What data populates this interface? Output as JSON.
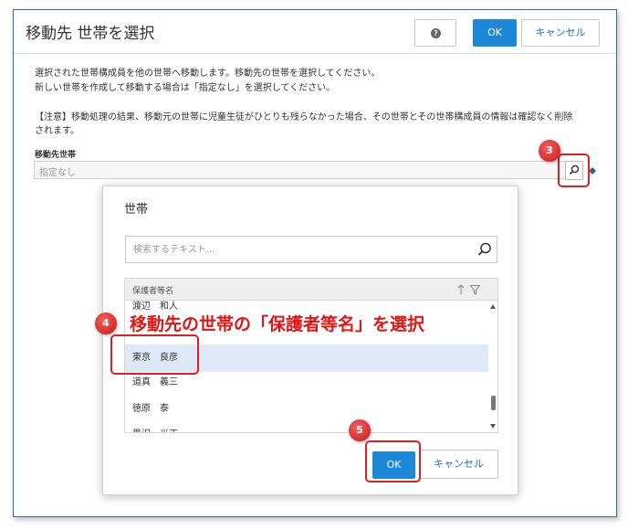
{
  "dialog": {
    "title": "移動先 世帯を選択",
    "ok_label": "OK",
    "cancel_label": "キャンセル",
    "desc_line1": "選択された世帯構成員を他の世帯へ移動します。移動先の世帯を選択してください。",
    "desc_line2": "新しい世帯を作成して移動する場合は「指定なし」を選択してください。",
    "notice_line1": "【注意】移動処理の結果、移動元の世帯に児童生徒がひとりも残らなかった場合、その世帯とその世帯構成員の情報は確認なく削除",
    "notice_line2": "されます。",
    "field_label": "移動先世帯",
    "field_value": "指定なし"
  },
  "modal": {
    "title": "世帯",
    "search_placeholder": "検索するテキスト...",
    "column_header": "保護者等名",
    "rows": [
      {
        "name": "渡辺　和人",
        "selected": false
      },
      {
        "name": "",
        "selected": false
      },
      {
        "name": "東京　良彦",
        "selected": true
      },
      {
        "name": "道真　義三",
        "selected": false
      },
      {
        "name": "徳原　泰",
        "selected": false
      },
      {
        "name": "黒沢　光正",
        "selected": false
      }
    ],
    "ok_label": "OK",
    "cancel_label": "キャンセル"
  },
  "annotations": {
    "step3": "3",
    "step4": "4",
    "step5": "5",
    "callout": "移動先の世帯の「保護者等名」を選択"
  },
  "colors": {
    "primary": "#1e88d8",
    "accent_red": "#e02020",
    "selected_row": "#dde9f8"
  }
}
